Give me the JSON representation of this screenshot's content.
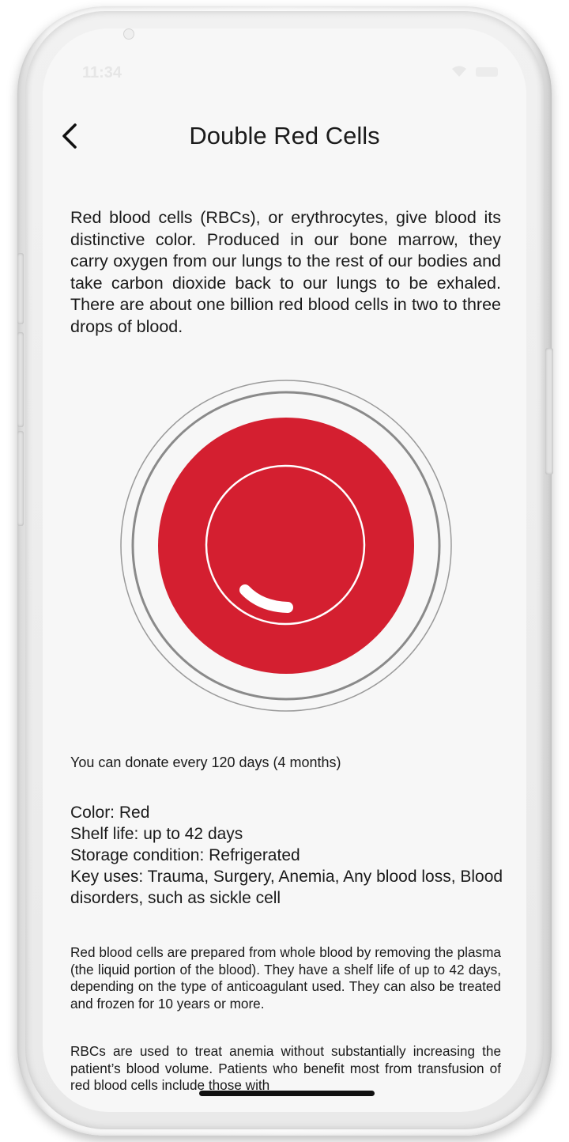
{
  "status_bar": {
    "time": "11:34"
  },
  "header": {
    "back_icon": "chevron-left-icon",
    "title": "Double Red Cells"
  },
  "intro": "Red blood cells (RBCs), or erythrocytes, give blood its distinctive color. Produced in our bone marrow, they carry oxygen from our lungs to the rest of our bodies and take carbon dioxide back to our lungs to be exhaled. There are about one billion red blood cells in two to three drops of blood.",
  "graphic": {
    "cell_color": "#d41f30",
    "ring_color": "#8a8a8a",
    "icon": "red-blood-cell-icon"
  },
  "donate_note": "You can donate every 120 days (4 months)",
  "facts": {
    "color": "Color: Red",
    "shelf_life": "Shelf life: up to 42 days",
    "storage": "Storage condition: Refrigerated",
    "key_uses": "Key uses: Trauma, Surgery, Anemia, Any blood loss, Blood disorders, such as sickle cell"
  },
  "paragraphs": [
    "Red blood cells are prepared from whole blood by removing the plasma (the liquid portion of the blood). They have a shelf life of up to 42 days, depending on the type of anticoagulant used. They can also be treated and frozen for 10 years or more.",
    "RBCs are used to treat anemia without substantially increasing the patient’s blood volume. Patients who benefit most from transfusion of red blood cells include those with"
  ]
}
